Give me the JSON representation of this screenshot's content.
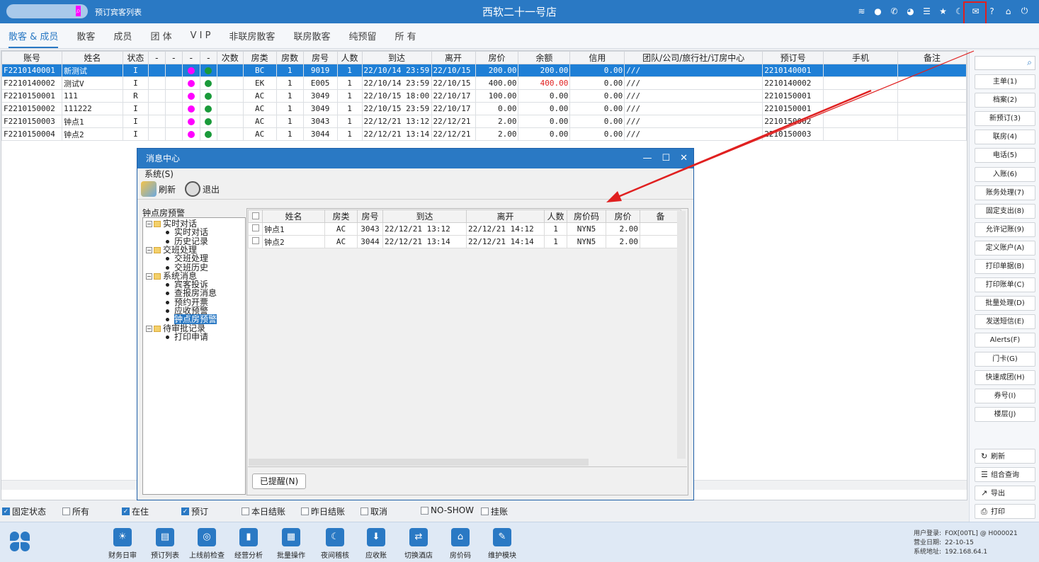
{
  "topbar": {
    "crumb": "预订宾客列表",
    "title": "西软二十一号店",
    "icons": [
      "wifi-icon",
      "chat-icon",
      "phone-icon",
      "palette-icon",
      "menu-icon",
      "star-icon",
      "moon-icon",
      "mail-icon",
      "help-icon",
      "home-icon",
      "power-icon"
    ],
    "accent": "#2a79c4"
  },
  "tabs": [
    {
      "label": "散客 & 成员",
      "active": true
    },
    {
      "label": "散客"
    },
    {
      "label": "成员"
    },
    {
      "label": "团 体"
    },
    {
      "label": "V I P"
    },
    {
      "label": "非联房散客"
    },
    {
      "label": "联房散客"
    },
    {
      "label": "纯预留"
    },
    {
      "label": "所 有"
    }
  ],
  "grid": {
    "columns": [
      "账号",
      "姓名",
      "状态",
      "-",
      "-",
      "-",
      "-",
      "次数",
      "房类",
      "房数",
      "房号",
      "人数",
      "到达",
      "离开",
      "房价",
      "余额",
      "信用",
      "团队/公司/旅行社/订房中心",
      "预订号",
      "手机",
      "备注"
    ],
    "rows": [
      {
        "acct": "F2210140001",
        "name": "新测试",
        "status": "I",
        "type": "BC",
        "qty": "1",
        "room": "9019",
        "people": "1",
        "arr": "22/10/14 23:59",
        "dep": "22/10/15",
        "rate": "200.00",
        "bal": "200.00",
        "neg": true,
        "credit": "0.00",
        "group": "///",
        "resv": "2210140001",
        "selected": true
      },
      {
        "acct": "F2210140002",
        "name": "测试V",
        "status": "I",
        "type": "EK",
        "qty": "1",
        "room": "E005",
        "people": "1",
        "arr": "22/10/14 23:59",
        "dep": "22/10/15",
        "rate": "400.00",
        "bal": "400.00",
        "neg": true,
        "credit": "0.00",
        "group": "///",
        "resv": "2210140002"
      },
      {
        "acct": "F2210150001",
        "name": "111",
        "status": "R",
        "type": "AC",
        "qty": "1",
        "room": "3049",
        "people": "1",
        "arr": "22/10/15 18:00",
        "dep": "22/10/17",
        "rate": "100.00",
        "bal": "0.00",
        "credit": "0.00",
        "group": "///",
        "resv": "2210150001"
      },
      {
        "acct": "F2210150002",
        "name": "111222",
        "status": "I",
        "type": "AC",
        "qty": "1",
        "room": "3049",
        "people": "1",
        "arr": "22/10/15 23:59",
        "dep": "22/10/17",
        "rate": "0.00",
        "bal": "0.00",
        "credit": "0.00",
        "group": "///",
        "resv": "2210150001"
      },
      {
        "acct": "F2210150003",
        "name": "钟点1",
        "status": "I",
        "type": "AC",
        "qty": "1",
        "room": "3043",
        "people": "1",
        "arr": "22/12/21 13:12",
        "dep": "22/12/21",
        "rate": "2.00",
        "bal": "0.00",
        "credit": "0.00",
        "group": "///",
        "resv": "2210150002"
      },
      {
        "acct": "F2210150004",
        "name": "钟点2",
        "status": "I",
        "type": "AC",
        "qty": "1",
        "room": "3044",
        "people": "1",
        "arr": "22/12/21 13:14",
        "dep": "22/12/21",
        "rate": "2.00",
        "bal": "0.00",
        "credit": "0.00",
        "group": "///",
        "resv": "2210150003"
      }
    ]
  },
  "right_panel": {
    "buttons": [
      "主单(1)",
      "档案(2)",
      "新预订(3)",
      "联房(4)",
      "电话(5)",
      "入账(6)",
      "账务处理(7)",
      "固定支出(8)",
      "允许记账(9)",
      "定义账户(A)",
      "打印单据(B)",
      "打印账单(C)",
      "批量处理(D)",
      "发送短信(E)",
      "Alerts(F)",
      "门卡(G)",
      "快速成团(H)",
      "券号(I)",
      "楼层(J)"
    ],
    "actions": [
      {
        "label": "刷新",
        "icon": "refresh-icon",
        "glyph": "↻"
      },
      {
        "label": "组合查询",
        "icon": "list-icon",
        "glyph": "☰"
      },
      {
        "label": "导出",
        "icon": "export-icon",
        "glyph": "↗"
      },
      {
        "label": "打印",
        "icon": "print-icon",
        "glyph": "⎙"
      }
    ]
  },
  "filters": [
    {
      "label": "固定状态",
      "checked": true
    },
    {
      "label": "所有",
      "checked": false
    },
    {
      "label": "在住",
      "checked": true
    },
    {
      "label": "预订",
      "checked": true
    },
    {
      "label": "本日结账",
      "checked": false
    },
    {
      "label": "昨日结账",
      "checked": false
    },
    {
      "label": "取消",
      "checked": false
    },
    {
      "label": "NO-SHOW",
      "checked": false
    },
    {
      "label": "挂账",
      "checked": false
    }
  ],
  "toolbar": [
    {
      "label": "财务日审",
      "glyph": "☀"
    },
    {
      "label": "预订列表",
      "glyph": "▤"
    },
    {
      "label": "上线前检查",
      "glyph": "◎"
    },
    {
      "label": "经营分析",
      "glyph": "▮"
    },
    {
      "label": "批量操作",
      "glyph": "▦"
    },
    {
      "label": "夜间稽核",
      "glyph": "☾"
    },
    {
      "label": "应收账",
      "glyph": "⬇"
    },
    {
      "label": "切换酒店",
      "glyph": "⇄"
    },
    {
      "label": "房价码",
      "glyph": "⌂"
    },
    {
      "label": "维护模块",
      "glyph": "✎"
    }
  ],
  "status": {
    "user_label": "用户登录:",
    "user": "FOX[00TL] @ H000021",
    "date_label": "营业日期:",
    "date": "22-10-15",
    "addr_label": "系统地址:",
    "addr": "192.168.64.1"
  },
  "dialog": {
    "title": "消息中心",
    "menu": "系统(S)",
    "refresh": "刷新",
    "exit": "退出",
    "tree_title": "钟点房预警",
    "tree": [
      {
        "label": "实时对话",
        "level": 0
      },
      {
        "label": "实时对话",
        "level": 1
      },
      {
        "label": "历史记录",
        "level": 1
      },
      {
        "label": "交班处理",
        "level": 0
      },
      {
        "label": "交班处理",
        "level": 1
      },
      {
        "label": "交班历史",
        "level": 1
      },
      {
        "label": "系统消息",
        "level": 0
      },
      {
        "label": "宾客投诉",
        "level": 1
      },
      {
        "label": "查报房消息",
        "level": 1
      },
      {
        "label": "预约开票",
        "level": 1
      },
      {
        "label": "应收预警",
        "level": 1
      },
      {
        "label": "钟点房预警",
        "level": 1,
        "selected": true
      },
      {
        "label": "待审批记录",
        "level": 0
      },
      {
        "label": "打印申请",
        "level": 1
      }
    ],
    "columns": [
      "姓名",
      "房类",
      "房号",
      "到达",
      "离开",
      "人数",
      "房价码",
      "房价",
      "备"
    ],
    "rows": [
      {
        "name": "钟点1",
        "type": "AC",
        "room": "3043",
        "arr": "22/12/21 13:12",
        "dep": "22/12/21 14:12",
        "people": "1",
        "code": "NYN5",
        "rate": "2.00"
      },
      {
        "name": "钟点2",
        "type": "AC",
        "room": "3044",
        "arr": "22/12/21 13:14",
        "dep": "22/12/21 14:14",
        "people": "1",
        "code": "NYN5",
        "rate": "2.00"
      }
    ],
    "remind_button": "已提醒(N)"
  }
}
